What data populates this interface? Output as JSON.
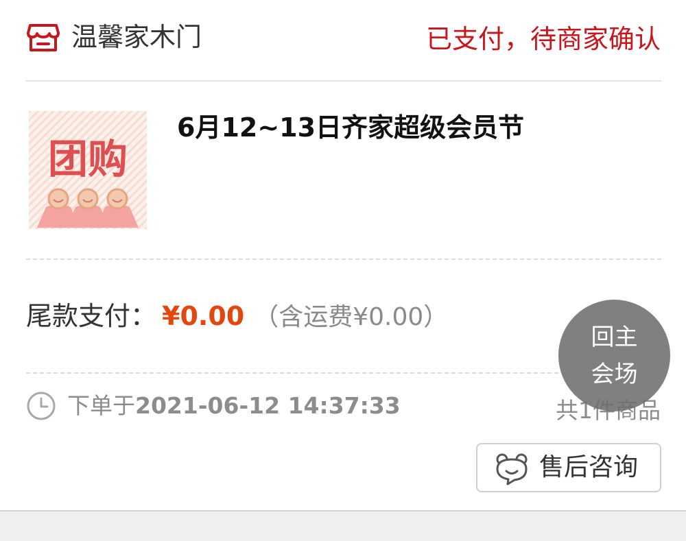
{
  "store": {
    "name": "温馨家木门",
    "icon": "store-icon",
    "status": "已支付，待商家确认"
  },
  "product": {
    "thumbnail_text": "团购",
    "title": "6月12~13日齐家超级会员节"
  },
  "payment": {
    "label": "尾款支付：",
    "amount": "¥0.00",
    "shipping": "（含运费¥0.00）"
  },
  "order": {
    "time_label": "下单于",
    "time": "2021-06-12 14:37:33",
    "item_count": "共1件商品"
  },
  "actions": {
    "after_sale_label": "售后咨询",
    "after_sale_icon": "service-bear-icon"
  },
  "float_button": {
    "line1": "回主",
    "line2": "会场"
  },
  "colors": {
    "status": "#c8161d",
    "price": "#e2470f",
    "muted": "#8c8c8c",
    "float_bg": "#6e6e6e"
  }
}
